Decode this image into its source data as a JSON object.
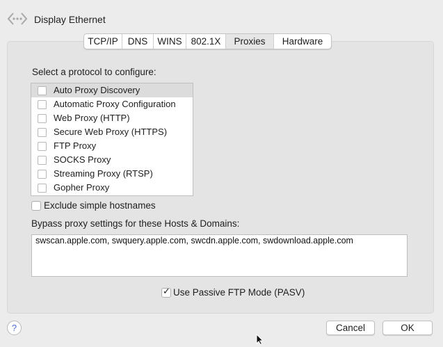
{
  "header": {
    "title": "Display Ethernet",
    "icon": "ethernet-icon"
  },
  "tabs": [
    {
      "label": "TCP/IP",
      "selected": false
    },
    {
      "label": "DNS",
      "selected": false
    },
    {
      "label": "WINS",
      "selected": false
    },
    {
      "label": "802.1X",
      "selected": false
    },
    {
      "label": "Proxies",
      "selected": true
    },
    {
      "label": "Hardware",
      "selected": false
    }
  ],
  "proxies": {
    "select_label": "Select a protocol to configure:",
    "protocols": [
      {
        "label": "Auto Proxy Discovery",
        "checked": false,
        "highlighted": true
      },
      {
        "label": "Automatic Proxy Configuration",
        "checked": false
      },
      {
        "label": "Web Proxy (HTTP)",
        "checked": false
      },
      {
        "label": "Secure Web Proxy (HTTPS)",
        "checked": false
      },
      {
        "label": "FTP Proxy",
        "checked": false
      },
      {
        "label": "SOCKS Proxy",
        "checked": false
      },
      {
        "label": "Streaming Proxy (RTSP)",
        "checked": false
      },
      {
        "label": "Gopher Proxy",
        "checked": false
      }
    ],
    "exclude_simple": {
      "label": "Exclude simple hostnames",
      "checked": false
    },
    "bypass_label": "Bypass proxy settings for these Hosts & Domains:",
    "bypass_value": "swscan.apple.com, swquery.apple.com, swcdn.apple.com, swdownload.apple.com",
    "passive_ftp": {
      "label": "Use Passive FTP Mode (PASV)",
      "checked": true,
      "check_glyph": "✓"
    }
  },
  "footer": {
    "help_label": "?",
    "cancel_label": "Cancel",
    "ok_label": "OK"
  },
  "colors": {
    "help_accent": "#4a6fd0"
  }
}
